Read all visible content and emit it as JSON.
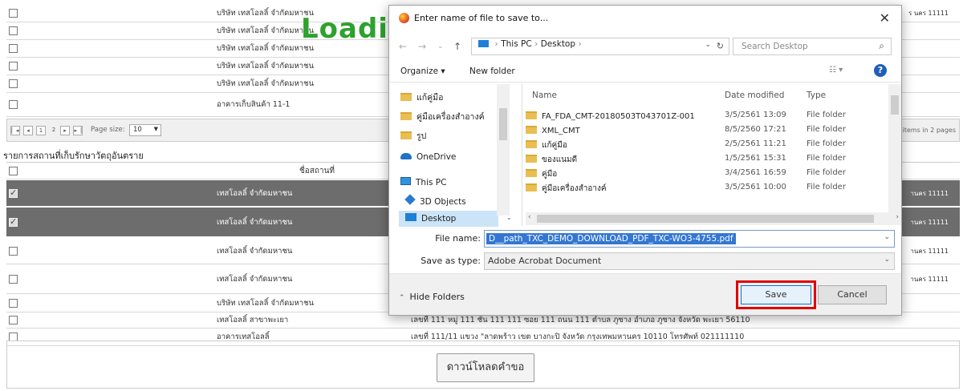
{
  "background": {
    "top_rows": [
      {
        "name": "บริษัท เทสโอลลิ์ จำกัดมหาชน"
      },
      {
        "name": "บริษัท เทสโอลลิ์ จำกัดมหาชน"
      },
      {
        "name": "บริษัท เทสโอลลิ์ จำกัดมหาชน"
      },
      {
        "name": "บริษัท เทสโอลลิ์ จำกัดมหาชน"
      },
      {
        "name": "บริษัท เทสโอลลิ์ จำกัดมหาชน"
      },
      {
        "name": "อาคารเก็บสินค้า 11-1"
      }
    ],
    "top_right_text": "ร นคร 11111",
    "pager": {
      "pages": [
        "1",
        "2"
      ],
      "page_size_label": "Page size:",
      "page_size": "10",
      "items_text": "items in 2 pages"
    },
    "section_title": "รายการสถานที่เก็บรักษาวัตถุอันตราย",
    "table_header": "ชื่อสถานที่",
    "rows": [
      {
        "name": "เทสโอลลิ์ จำกัดมหาชน",
        "checked": true,
        "dark": true,
        "right": "านคร 11111"
      },
      {
        "name": "เทสโอลลิ์ จำกัดมหาชน",
        "checked": true,
        "dark": true,
        "right": "านคร 11111"
      },
      {
        "name": "เทสโอลลิ์ จำกัดมหาชน",
        "checked": false,
        "dark": false,
        "right": "านคร 11111"
      },
      {
        "name": "เทสโอลลิ์ จำกัดมหาชน",
        "checked": false,
        "dark": false,
        "right": "านคร 11111"
      },
      {
        "name": "บริษัท เทสโอลลิ์ จำกัดมหาชน",
        "checked": false,
        "dark": false,
        "right": ""
      },
      {
        "name": "เทสโอลลิ์ สาขาพะเยา",
        "checked": false,
        "dark": false,
        "address": "เลขที่ 111 หมู่ 111 ชั้น 111 111 ซอย 111 ถนน 111 ตำบล ภูซาง อำเภอ ภูซาง จังหวัด พะเยา 56110"
      },
      {
        "name": "อาคารเทสโอลลิ์",
        "checked": false,
        "dark": false,
        "address": "เลขที่ 111/11 แขวง \"ลาดพร้าว เขต บางกะปิ จังหวัด กรุงเทพมหานคร 10110 โทรศัพท์ 021111110"
      }
    ],
    "loading_text": "Loadin",
    "download_button": "ดาวน์โหลดคำขอ"
  },
  "dialog": {
    "title": "Enter name of file to save to...",
    "close": "✕",
    "breadcrumb": [
      "This PC",
      "Desktop"
    ],
    "search_placeholder": "Search Desktop",
    "organize": "Organize ▾",
    "new_folder": "New folder",
    "sidebar": [
      {
        "label": "แก้คู่มือ",
        "icon": "folder-icon"
      },
      {
        "label": "คู่มือเครื่องสำอางค์",
        "icon": "folder-icon"
      },
      {
        "label": "รูป",
        "icon": "folder-icon"
      },
      {
        "label": "OneDrive",
        "icon": "onedrive-icon"
      },
      {
        "label": "This PC",
        "icon": "computer-icon"
      },
      {
        "label": "3D Objects",
        "icon": "cube-icon"
      },
      {
        "label": "Desktop",
        "icon": "desktop-icon",
        "selected": true
      }
    ],
    "columns": {
      "name": "Name",
      "date": "Date modified",
      "type": "Type"
    },
    "files": [
      {
        "name": "FA_FDA_CMT-20180503T043701Z-001",
        "date": "3/5/2561 13:09",
        "type": "File folder"
      },
      {
        "name": "XML_CMT",
        "date": "8/5/2560 17:21",
        "type": "File folder"
      },
      {
        "name": "แก้คู่มือ",
        "date": "2/5/2561 11:21",
        "type": "File folder"
      },
      {
        "name": "ของแนมดี",
        "date": "1/5/2561 15:31",
        "type": "File folder"
      },
      {
        "name": "คู่มือ",
        "date": "3/4/2561 16:59",
        "type": "File folder"
      },
      {
        "name": "คู่มือเครื่องสำอางค์",
        "date": "3/5/2561 10:00",
        "type": "File folder"
      }
    ],
    "file_name_label": "File name:",
    "file_name": "D__path_TXC_DEMO_DOWNLOAD_PDF_TXC-WO3-4755.pdf",
    "save_type_label": "Save as type:",
    "save_type": "Adobe Acrobat Document",
    "hide_folders": "Hide Folders",
    "save": "Save",
    "cancel": "Cancel"
  },
  "colors": {
    "accent": "#3377d2",
    "highlight": "#e00000",
    "dark_row": "#6d6d6d",
    "loading": "#2ea12e"
  }
}
